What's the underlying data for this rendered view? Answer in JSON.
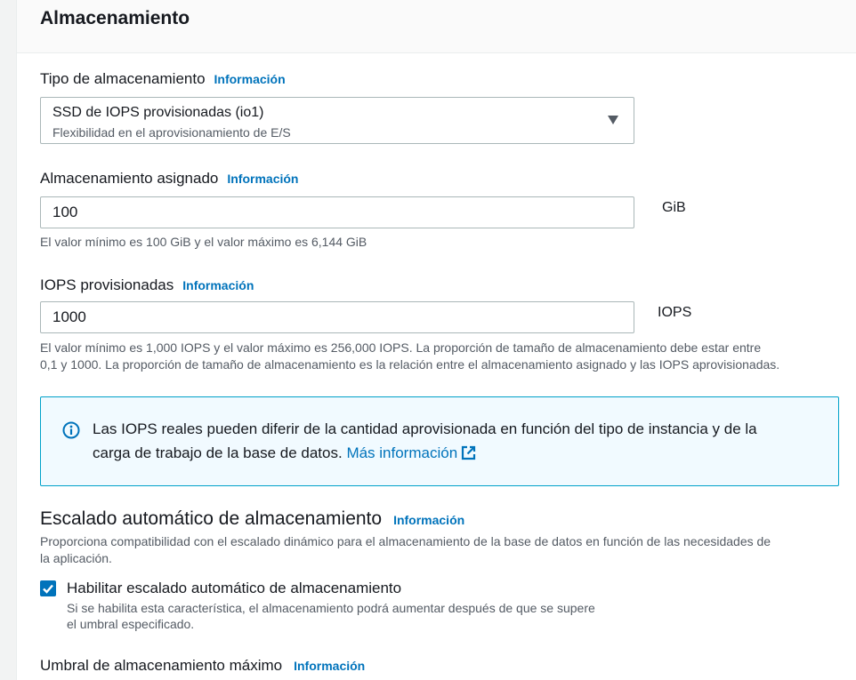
{
  "storage": {
    "title": "Almacenamiento",
    "info_label": "Información",
    "type": {
      "label": "Tipo de almacenamiento",
      "selected": "SSD de IOPS provisionadas (io1)",
      "description": "Flexibilidad en el aprovisionamiento de E/S"
    },
    "allocated": {
      "label": "Almacenamiento asignado",
      "value": "100",
      "unit": "GiB",
      "hint": "El valor mínimo es 100 GiB y el valor máximo es 6,144 GiB"
    },
    "iops": {
      "label": "IOPS provisionadas",
      "value": "1000",
      "unit": "IOPS",
      "hint_line1": "El valor mínimo es 1,000 IOPS y el valor máximo es 256,000 IOPS. La proporción de tamaño de almacenamiento debe estar entre",
      "hint_line2": "0,1 y 1000. La proporción de tamaño de almacenamiento es la relación entre el almacenamiento asignado y las IOPS aprovisionadas."
    },
    "alert": {
      "text_line1": "Las IOPS reales pueden diferir de la cantidad aprovisionada en función del tipo de instancia y de la",
      "text_line2": "carga de trabajo de la base de datos.",
      "link": "Más información"
    },
    "autoscaling": {
      "title": "Escalado automático de almacenamiento",
      "description_line1": "Proporciona compatibilidad con el escalado dinámico para el almacenamiento de la base de datos en función de las necesidades de",
      "description_line2": "la aplicación.",
      "checkbox_label": "Habilitar escalado automático de almacenamiento",
      "checkbox_checked": true,
      "checkbox_hint_line1": "Si se habilita esta característica, el almacenamiento podrá aumentar después de que se supere",
      "checkbox_hint_line2": "el umbral especificado."
    },
    "max_threshold": {
      "label": "Umbral de almacenamiento máximo"
    }
  },
  "colors": {
    "link": "#0073bb",
    "alert_border": "#00a1c9",
    "alert_bg": "#f1faff"
  }
}
